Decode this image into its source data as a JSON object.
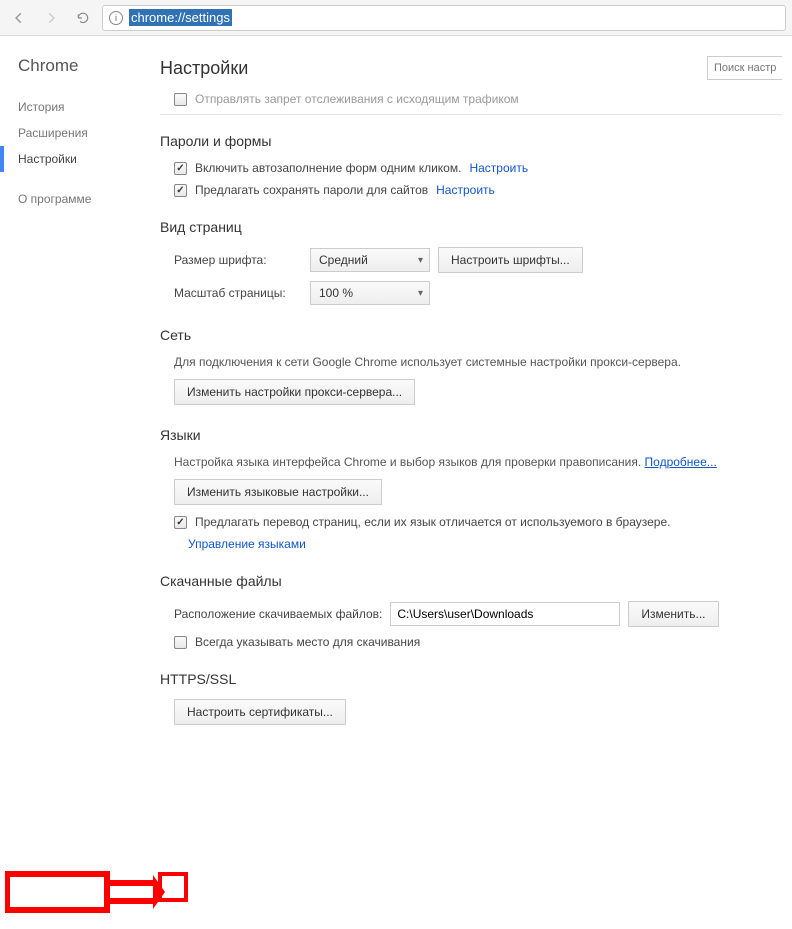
{
  "toolbar": {
    "url": "chrome://settings"
  },
  "sidebar": {
    "title": "Chrome",
    "items": [
      {
        "label": "История",
        "active": false
      },
      {
        "label": "Расширения",
        "active": false
      },
      {
        "label": "Настройки",
        "active": true
      },
      {
        "label": "О программе",
        "active": false
      }
    ]
  },
  "header": {
    "title": "Настройки",
    "search_placeholder": "Поиск настро"
  },
  "truncated_row": {
    "label": "Отправлять запрет отслеживания с исходящим трафиком"
  },
  "passwords": {
    "title": "Пароли и формы",
    "autofill": "Включить автозаполнение форм одним кликом.",
    "autofill_link": "Настроить",
    "save_pw": "Предлагать сохранять пароли для сайтов",
    "save_pw_link": "Настроить"
  },
  "appearance": {
    "title": "Вид страниц",
    "font_label": "Размер шрифта:",
    "font_value": "Средний",
    "font_btn": "Настроить шрифты...",
    "zoom_label": "Масштаб страницы:",
    "zoom_value": "100 %"
  },
  "network": {
    "title": "Сеть",
    "desc": "Для подключения к сети Google Chrome использует системные настройки прокси-сервера.",
    "btn": "Изменить настройки прокси-сервера..."
  },
  "languages": {
    "title": "Языки",
    "desc": "Настройка языка интерфейса Chrome и выбор языков для проверки правописания.",
    "more": "Подробнее...",
    "btn": "Изменить языковые настройки...",
    "translate": "Предлагать перевод страниц, если их язык отличается от используемого в браузере.",
    "manage": "Управление языками"
  },
  "downloads": {
    "title": "Скачанные файлы",
    "path_label": "Расположение скачиваемых файлов:",
    "path_value": "C:\\Users\\user\\Downloads",
    "change": "Изменить...",
    "ask": "Всегда указывать место для скачивания"
  },
  "ssl": {
    "title": "HTTPS/SSL",
    "btn": "Настроить сертификаты..."
  }
}
